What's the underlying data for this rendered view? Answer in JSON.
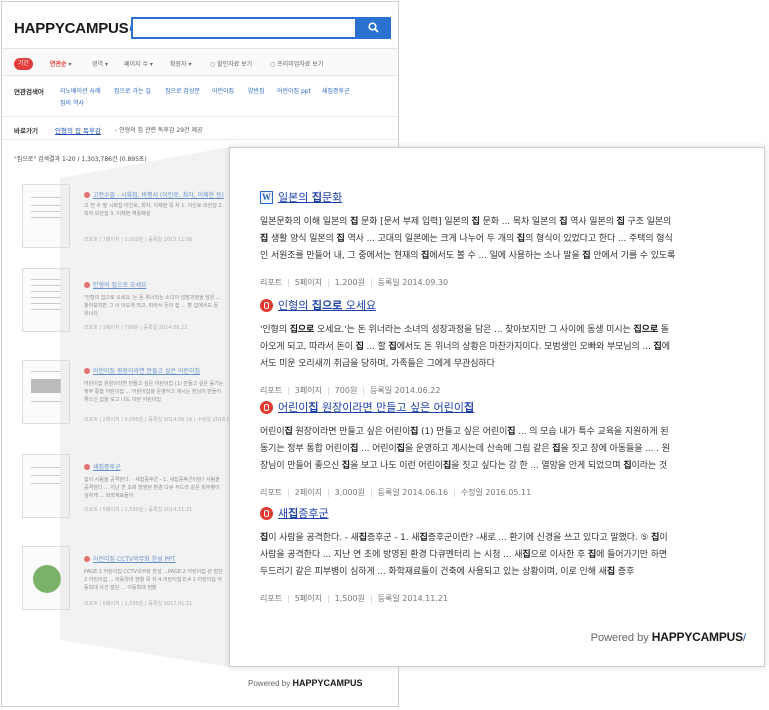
{
  "brand": {
    "logo": "HAPPYCAMPUS",
    "powered_by": "Powered by",
    "powered_brand": "HAPPYCAMPUS"
  },
  "search": {
    "value": "",
    "button_icon": "search-icon"
  },
  "filters": {
    "active_chip": "기간",
    "options": [
      "연관순",
      "영역",
      "페이지 수",
      "확장자",
      "할인자료 보기",
      "프리미엄자료 보기"
    ]
  },
  "related": {
    "label": "연관검색어",
    "keywords": [
      "리노베이션 사례",
      "집으로 가는 길",
      "집으로 감상문",
      "어린이집",
      "양반집",
      "어린이집 ppt",
      "새집증후군",
      "집의 역사"
    ]
  },
  "quick_link": {
    "label": "바로가기",
    "link": "인형의 집 독후감",
    "desc": "- 인형의 집 관련 독후감 29건 제공"
  },
  "result_count": "\"집으로\" 검색결과 1-20 / 1,303,786건 (0.895초)",
  "background_results": [
    {
      "title": "고전수필 - 시화집, 비평서 (이인로, 최자, 이제현 등)",
      "snippet": "고 전 수 필 시화집·이인로, 최자, 이제현 목 차 1. 이인로 파한집 2. 최자 보한집 3. 이제현 역옹패설",
      "meta": "리포트 | 7페이지 | 1,000원 | 등록일 2013.11.06"
    },
    {
      "title": "인형의 집으로 오세요",
      "snippet": "'인형의 집으로 오세요.'는 돈 위너라는 소녀의 성장과정을 담은 ... 찾아보지만 그 사 아오게 되고, 따라서 돈이 집 ... 할 집에서도 돈 위너의",
      "meta": "리포트 | 3페이지 | 700원 | 등록일 2014.06.22"
    },
    {
      "title": "어린이집 원장이라면 만들고 싶은 어린이집",
      "snippet": "어린이집 원장이라면 만들고 싶은 어린이집 (1) 만들고 싶은 동기는 정부 통합 어린이집 ... 어린이집을 운영하고 계시는 장님이 만들어 좋으신 집을 보고 나도 이런 어린이집",
      "meta": "리포트 | 2페이지 | 3,000원 | 등록일 2014.06.16 | 수정일 2016.05.11"
    },
    {
      "title": "새집증후군",
      "snippet": "집이 사람을 공격한다. - 새집증후군 - 1. 새집증후군이란? 사람을 공격한다 ... 지난 연 초에 방영된 환경 다큐 두드려 같은 피부병이 심하게 ... 화학재료들이",
      "meta": "리포트 | 5페이지 | 1,500원 | 등록일 2014.11.21"
    },
    {
      "title": "어린이집 CCTV의무화 찬성 PPT",
      "snippet": "PAGE:1 어린이집 CCTV의무화 찬성 ...PAGE:2 어린이집 관 발단 2 어린이집 ... 아동학대 현황 목 차 4 어린이집 E:4 1 어린이집 아동학대 사건 발단 ... 아동학대 현황",
      "meta": "리포트 | 6페이지 | 2,500원 | 등록일 2017.01.11"
    }
  ],
  "zoom_results": [
    {
      "icon": "word-doc-icon",
      "title_parts": [
        "일본의 ",
        "집",
        "문화"
      ],
      "body_lines": [
        [
          [
            "일본문화의 이해 일본의 ",
            0
          ],
          [
            "집",
            1
          ],
          [
            " 문화 [문서 부제 입력] 일본의 ",
            0
          ],
          [
            "집",
            1
          ],
          [
            " 문화 ... 목차 일본의 ",
            0
          ],
          [
            "집",
            1
          ],
          [
            " 역사 일본의 ",
            0
          ],
          [
            "집",
            1
          ],
          [
            " 구조 일본의",
            0
          ]
        ],
        [
          [
            "집",
            1
          ],
          [
            " 생활 양식 일본의 ",
            0
          ],
          [
            "집",
            1
          ],
          [
            " 역사 ... 고대의 일본에는 크게 나누어 두 개의 ",
            0
          ],
          [
            "집",
            1
          ],
          [
            "의 형식이 있었다고 한다 ... 주택의 형식",
            0
          ]
        ],
        [
          [
            "인 서원조를 만들어 내, 그 중에서는 현재의 ",
            0
          ],
          [
            "집",
            1
          ],
          [
            "에서도 볼 수 ... 일에 사용하는 소나 말을 ",
            0
          ],
          [
            "집",
            1
          ],
          [
            " 안에서 기를 수 있도록",
            0
          ]
        ]
      ],
      "meta": [
        "리포트",
        "5페이지",
        "1,200원",
        "등록일 2014.09.30"
      ]
    },
    {
      "icon": "pdf-doc-icon",
      "title_parts": [
        "인형의 ",
        "집으로",
        " 오세요"
      ],
      "body_lines": [
        [
          [
            "'인형의 ",
            0
          ],
          [
            "집으로",
            1
          ],
          [
            " 오세요.'는 돈 위너라는 소녀의 성장과정을 담은 ... 찾아보지만 그 사이에 동생 미시는 ",
            0
          ],
          [
            "집으로",
            1
          ],
          [
            " 돌",
            0
          ]
        ],
        [
          [
            "아오게 되고, 따라서 돈이 ",
            0
          ],
          [
            "집",
            1
          ],
          [
            " ... 할 ",
            0
          ],
          [
            "집",
            1
          ],
          [
            "에서도 돈 위너의 상황은 마찬가지이다. 모범생인 오빠와 부모님의 ... ",
            0
          ],
          [
            "집",
            1
          ],
          [
            "에",
            0
          ]
        ],
        [
          [
            "서도 미운 오리새끼 취급을 당하며, 가족들은 그에게 무관심하다",
            0
          ]
        ]
      ],
      "meta": [
        "리포트",
        "3페이지",
        "700원",
        "등록일 2014.06.22"
      ]
    },
    {
      "icon": "pdf-doc-icon",
      "title_parts": [
        "어린이",
        "집",
        " 원장이라면 만들고 싶은 어린이",
        "집"
      ],
      "body_lines": [
        [
          [
            "어린이",
            0
          ],
          [
            "집",
            1
          ],
          [
            " 원장이라면 만들고 싶은 어린이",
            0
          ],
          [
            "집",
            1
          ],
          [
            " (1) 만들고 싶은 어린이",
            0
          ],
          [
            "집",
            1
          ],
          [
            " ... 의 모습 내가 특수 교육을 지원하게 된",
            0
          ]
        ],
        [
          [
            "동기는 정부 통합 어린이",
            0
          ],
          [
            "집",
            1
          ],
          [
            " ... 어린이",
            0
          ],
          [
            "집",
            1
          ],
          [
            "을 운영하고 계시는데 산속에 그림 같은 ",
            0
          ],
          [
            "집",
            1
          ],
          [
            "을 짓고 장에 아동들을 ... . 원",
            0
          ]
        ],
        [
          [
            "장님이 만들어 좋으신 ",
            0
          ],
          [
            "집",
            1
          ],
          [
            "을 보고 나도 이런 어린이",
            0
          ],
          [
            "집",
            1
          ],
          [
            "을 짓고 싶다는 강 한 ... 열망을 안게 되었으며 ",
            0
          ],
          [
            "집",
            1
          ],
          [
            "이라는 것",
            0
          ]
        ]
      ],
      "meta": [
        "리포트",
        "2페이지",
        "3,000원",
        "등록일 2014.06.16",
        "수정일 2016.05.11"
      ]
    },
    {
      "icon": "pdf-doc-icon",
      "title_parts": [
        "새",
        "집",
        "증후군"
      ],
      "body_lines": [
        [
          [
            "집",
            1
          ],
          [
            "이 사람을 공격한다. - 새",
            0
          ],
          [
            "집",
            1
          ],
          [
            "증후군 - 1. 새",
            0
          ],
          [
            "집",
            1
          ],
          [
            "증후군이란? -새로 ... 환기에 신경을 쓰고 있다고 말했다. ⑤ ",
            0
          ],
          [
            "집",
            1
          ],
          [
            "이",
            0
          ]
        ],
        [
          [
            "사람을 공격한다 ... 지난 연 초에 방영된 환경 다큐멘터리 는 시청 ... 새",
            0
          ],
          [
            "집",
            1
          ],
          [
            "으로 이사한 후 ",
            0
          ],
          [
            "집",
            1
          ],
          [
            "에 들어가기만 하면",
            0
          ]
        ],
        [
          [
            "두드러기 같은 피부병이 심하게 ... 화학재료들이 건축에 사용되고 있는 상황이며, 이로 인해 새",
            0
          ],
          [
            "집",
            1
          ],
          [
            " 증후",
            0
          ]
        ]
      ],
      "meta": [
        "리포트",
        "5페이지",
        "1,500원",
        "등록일 2014.11.21"
      ]
    }
  ]
}
